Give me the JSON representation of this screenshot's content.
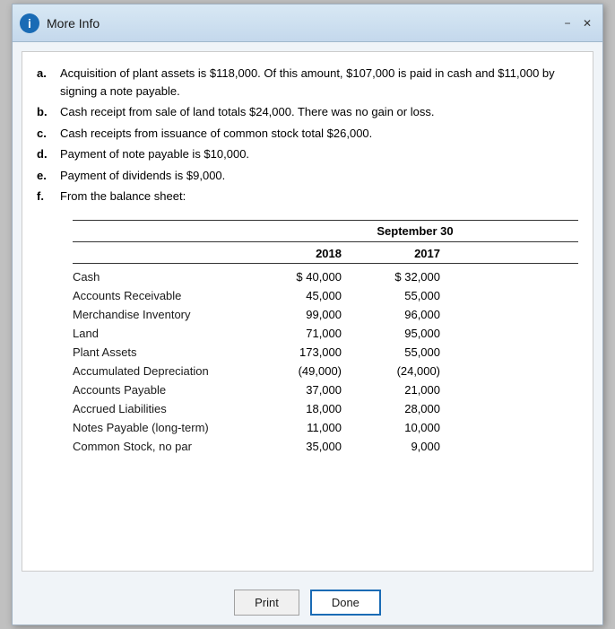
{
  "window": {
    "title": "More Info",
    "icon_label": "i",
    "minimize_label": "−",
    "close_label": "✕"
  },
  "notes": [
    {
      "id": "a",
      "text": "Acquisition of plant assets is $118,000. Of this amount, $107,000 is paid in cash and $11,000 by signing a note payable."
    },
    {
      "id": "b",
      "text": "Cash receipt from sale of land totals $24,000. There was no gain or loss."
    },
    {
      "id": "c",
      "text": "Cash receipts from issuance of common stock total $26,000."
    },
    {
      "id": "d",
      "text": "Payment of note payable is $10,000."
    },
    {
      "id": "e",
      "text": "Payment of dividends is $9,000."
    },
    {
      "id": "f",
      "text": "From the balance sheet:"
    }
  ],
  "balance_sheet": {
    "header": "September 30",
    "year1": "2018",
    "year2": "2017",
    "rows": [
      {
        "name": "Cash",
        "val2018": "$ 40,000",
        "val2017": "$ 32,000",
        "first": true
      },
      {
        "name": "Accounts Receivable",
        "val2018": "45,000",
        "val2017": "55,000",
        "first": false
      },
      {
        "name": "Merchandise Inventory",
        "val2018": "99,000",
        "val2017": "96,000",
        "first": false
      },
      {
        "name": "Land",
        "val2018": "71,000",
        "val2017": "95,000",
        "first": false
      },
      {
        "name": "Plant Assets",
        "val2018": "173,000",
        "val2017": "55,000",
        "first": false
      },
      {
        "name": "Accumulated Depreciation",
        "val2018": "(49,000)",
        "val2017": "(24,000)",
        "first": false
      },
      {
        "name": "Accounts Payable",
        "val2018": "37,000",
        "val2017": "21,000",
        "first": false
      },
      {
        "name": "Accrued Liabilities",
        "val2018": "18,000",
        "val2017": "28,000",
        "first": false
      },
      {
        "name": "Notes Payable (long-term)",
        "val2018": "11,000",
        "val2017": "10,000",
        "first": false
      },
      {
        "name": "Common Stock, no par",
        "val2018": "35,000",
        "val2017": "9,000",
        "first": false
      }
    ]
  },
  "footer": {
    "print_label": "Print",
    "done_label": "Done"
  }
}
